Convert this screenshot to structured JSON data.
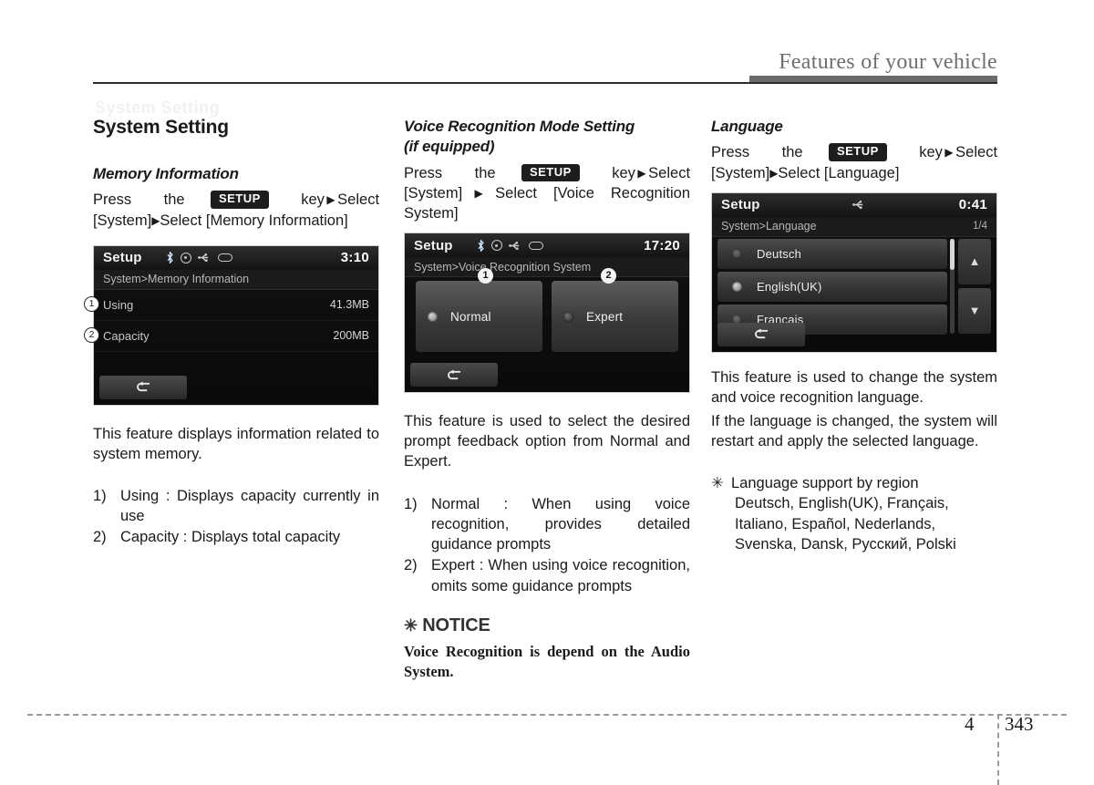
{
  "header": {
    "title": "Features of your vehicle"
  },
  "footer": {
    "chapter": "4",
    "page": "343"
  },
  "column1": {
    "section_title": "System Setting",
    "sub_title": "Memory Information",
    "instruction_pre": "Press",
    "instruction_the": "the",
    "setup_key": "SETUP",
    "instruction_key": "key",
    "instruction_select1": "Select",
    "instruction_system": "[System]",
    "instruction_select2": "Select [Memory Information]",
    "device": {
      "title": "Setup",
      "clock": "3:10",
      "breadcrumb": "System>Memory Information",
      "rows": [
        {
          "callout": "1",
          "label": "Using",
          "value": "41.3MB"
        },
        {
          "callout": "2",
          "label": "Capacity",
          "value": "200MB"
        }
      ],
      "back_label": "back-arrow"
    },
    "description": "This feature displays information related to system memory.",
    "list": [
      {
        "marker": "1)",
        "text": "Using : Displays capacity currently in use"
      },
      {
        "marker": "2)",
        "text": "Capacity : Displays total capacity"
      }
    ]
  },
  "column2": {
    "sub_title_line1": "Voice Recognition Mode Setting",
    "sub_title_line2": "(if equipped)",
    "instruction_pre": "Press",
    "instruction_the": "the",
    "setup_key": "SETUP",
    "instruction_key": "key",
    "instruction_select1": "Select",
    "instruction_system": "[System]",
    "instruction_select2": "Select [Voice Recognition System]",
    "device": {
      "title": "Setup",
      "clock": "17:20",
      "breadcrumb": "System>Voice Recognition System",
      "options": [
        {
          "callout": "1",
          "label": "Normal",
          "selected": true
        },
        {
          "callout": "2",
          "label": "Expert",
          "selected": false
        }
      ],
      "back_label": "back-arrow"
    },
    "description": "This feature is used to select the desired prompt feedback option from Normal and Expert.",
    "list": [
      {
        "marker": "1)",
        "text": "Normal : When using voice recognition, provides detailed guidance prompts"
      },
      {
        "marker": "2)",
        "text": "Expert : When using voice recognition, omits some guidance prompts"
      }
    ],
    "notice": {
      "star": "✳",
      "heading": "NOTICE",
      "body": "Voice Recognition is depend on the Audio System."
    }
  },
  "column3": {
    "sub_title": "Language",
    "instruction_pre": "Press",
    "instruction_the": "the",
    "setup_key": "SETUP",
    "instruction_key": "key",
    "instruction_select1": "Select",
    "instruction_system": "[System]",
    "instruction_select2": "Select [Language]",
    "device": {
      "title": "Setup",
      "clock": "0:41",
      "breadcrumb": "System>Language",
      "page_indicator": "1/4",
      "languages": [
        {
          "label": "Deutsch",
          "selected": false
        },
        {
          "label": "English(UK)",
          "selected": true
        },
        {
          "label": "Français",
          "selected": false
        }
      ],
      "scroll_up": "▲",
      "scroll_down": "▼",
      "back_label": "back-arrow"
    },
    "description1": "This feature is used to change the system and voice recognition language.",
    "description2": "If the language is changed, the system will restart and apply the selected language.",
    "note": {
      "star": "✳",
      "heading": "Language support by region",
      "lines": [
        "Deutsch, English(UK), Français,",
        "Italiano, Español, Nederlands,",
        "Svenska, Dansk, Русский, Polski"
      ]
    }
  },
  "ghost_text": "System Setting"
}
